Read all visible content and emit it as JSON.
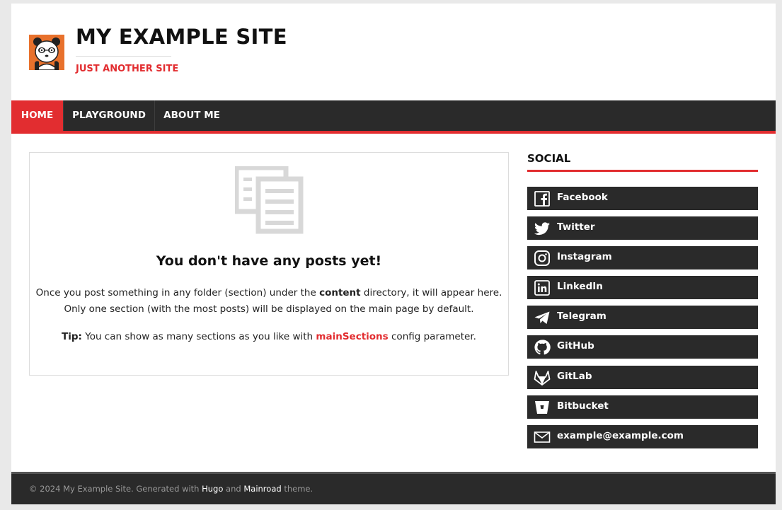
{
  "site": {
    "title": "MY EXAMPLE SITE",
    "tagline": "JUST ANOTHER SITE"
  },
  "nav": {
    "home": "HOME",
    "playground": "PLAYGROUND",
    "about": "ABOUT ME"
  },
  "main": {
    "heading": "You don't have any posts yet!",
    "line1_pre": "Once you post something in any folder (section) under the ",
    "line1_bold": "content",
    "line1_post": " directory, it will appear here.",
    "line2": "Only one section (with the most posts) will be displayed on the main page by default.",
    "tip_label": "Tip:",
    "tip_pre": " You can show as many sections as you like with ",
    "tip_link": "mainSections",
    "tip_post": " config parameter."
  },
  "sidebar": {
    "title": "SOCIAL",
    "items": [
      {
        "label": "Facebook",
        "icon": "facebook-icon"
      },
      {
        "label": "Twitter",
        "icon": "twitter-icon"
      },
      {
        "label": "Instagram",
        "icon": "instagram-icon"
      },
      {
        "label": "LinkedIn",
        "icon": "linkedin-icon"
      },
      {
        "label": "Telegram",
        "icon": "telegram-icon"
      },
      {
        "label": "GitHub",
        "icon": "github-icon"
      },
      {
        "label": "GitLab",
        "icon": "gitlab-icon"
      },
      {
        "label": "Bitbucket",
        "icon": "bitbucket-icon"
      },
      {
        "label": "example@example.com",
        "icon": "mail-icon"
      }
    ]
  },
  "footer": {
    "pre": "© 2024 My Example Site. Generated with ",
    "hugo": "Hugo",
    "mid": " and ",
    "theme": "Mainroad",
    "post": " theme."
  },
  "colors": {
    "accent": "#e22d30",
    "dark": "#2a2a2a",
    "logo_bg": "#e8712c"
  }
}
